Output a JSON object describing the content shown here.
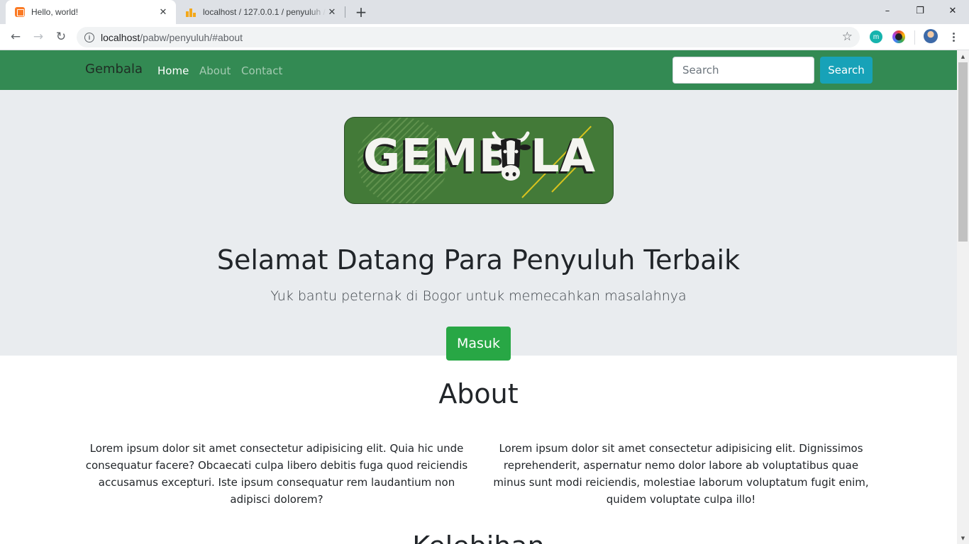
{
  "browser": {
    "tabs": [
      {
        "title": "Hello, world!",
        "active": true,
        "icon": "xampp-icon"
      },
      {
        "title": "localhost / 127.0.0.1 / penyuluh / ",
        "active": false,
        "icon": "phpmyadmin-icon"
      }
    ],
    "url_host": "localhost",
    "url_path": "/pabw/penyuluh/#about",
    "window_controls": {
      "minimize": "–",
      "maximize": "❐",
      "close": "✕"
    }
  },
  "site": {
    "brand": "Gembala",
    "nav": [
      {
        "label": "Home",
        "active": true
      },
      {
        "label": "About",
        "active": false
      },
      {
        "label": "Contact",
        "active": false
      }
    ],
    "search": {
      "placeholder": "Search",
      "button_label": "Search"
    }
  },
  "hero": {
    "logo_text": "GEMB LA",
    "title": "Selamat Datang Para Penyuluh Terbaik",
    "subtitle": "Yuk bantu peternak di Bogor untuk memecahkan masalahnya",
    "button_label": "Masuk"
  },
  "about": {
    "title": "About",
    "paragraphs": [
      "Lorem ipsum dolor sit amet consectetur adipisicing elit. Quia hic unde consequatur facere? Obcaecati culpa libero debitis fuga quod reiciendis accusamus excepturi. Iste ipsum consequatur rem laudantium non adipisci dolorem?",
      "Lorem ipsum dolor sit amet consectetur adipisicing elit. Dignissimos reprehenderit, aspernatur nemo dolor labore ab voluptatibus quae minus sunt modi reiciendis, molestiae laborum voluptatum fugit enim, quidem voluptate culpa illo!"
    ],
    "next_section_title": "Kelebihan"
  },
  "colors": {
    "navbar": "#338a53",
    "search_button": "#17a2b8",
    "masuk_button": "#28a745",
    "jumbotron": "#e9ecef"
  }
}
